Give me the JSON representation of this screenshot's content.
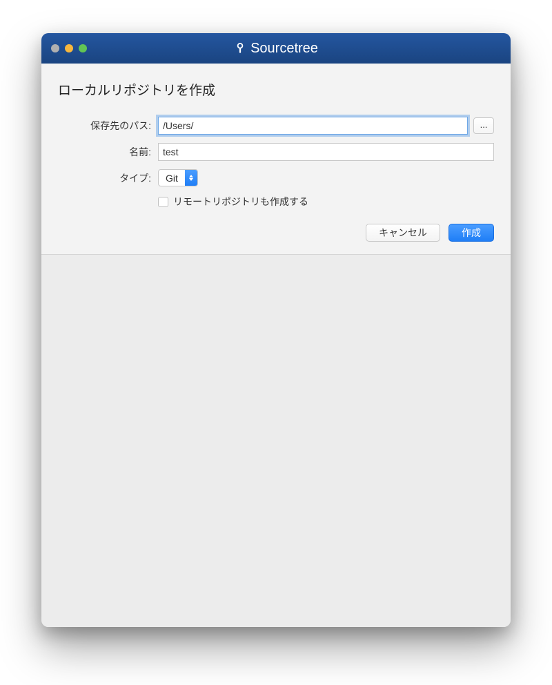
{
  "window": {
    "title": "Sourcetree"
  },
  "dialog": {
    "title": "ローカルリポジトリを作成",
    "fields": {
      "path_label": "保存先のパス:",
      "path_value": "/Users/",
      "browse_label": "...",
      "name_label": "名前:",
      "name_value": "test",
      "type_label": "タイプ:",
      "type_value": "Git"
    },
    "checkbox": {
      "label": "リモートリポジトリも作成する"
    },
    "buttons": {
      "cancel": "キャンセル",
      "create": "作成"
    }
  }
}
